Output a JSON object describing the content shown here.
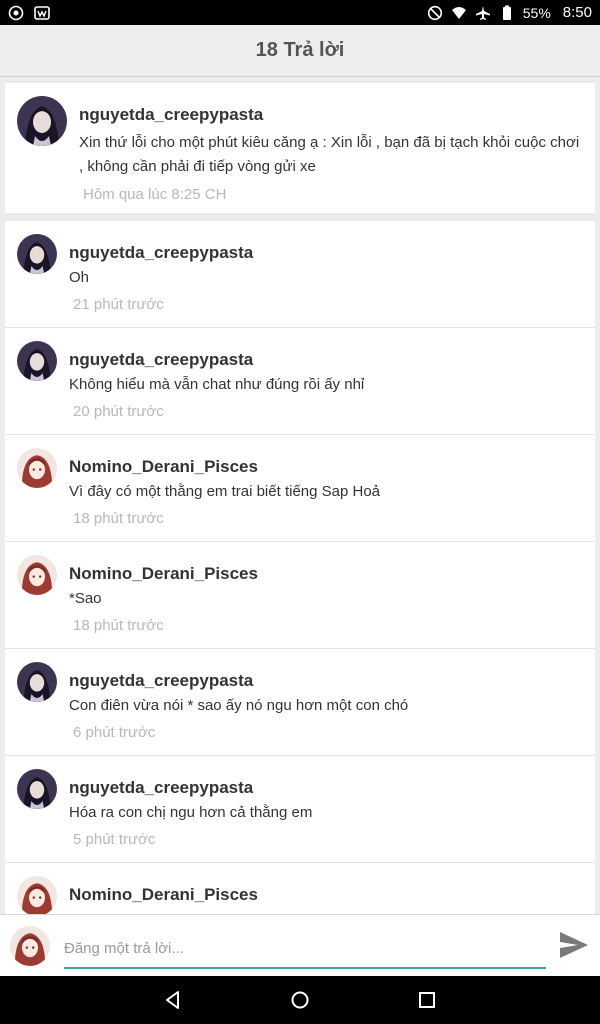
{
  "status_bar": {
    "battery": "55%",
    "time": "8:50",
    "icons": [
      "camera-icon",
      "app-icon",
      "dnd-icon",
      "wifi-icon",
      "airplane-icon",
      "battery-icon"
    ]
  },
  "header": {
    "title": "18 Trả lời"
  },
  "original_post": {
    "author": "nguyetda_creepypasta",
    "text": "Xin thứ lỗi cho một phút kiêu căng ạ : Xin lỗi , bạn đã bị tạch khỏi cuộc chơi , không cần phải đi tiếp vòng gửi xe",
    "time": "Hôm qua lúc 8:25 CH"
  },
  "replies": [
    {
      "author": "nguyetda_creepypasta",
      "text": "Oh",
      "time": "21 phút trước",
      "avatar": "dark"
    },
    {
      "author": "nguyetda_creepypasta",
      "text": "Không hiểu mà vẫn chat như đúng rồi ấy nhỉ",
      "time": "20 phút trước",
      "avatar": "dark"
    },
    {
      "author": "Nomino_Derani_Pisces",
      "text": "Vì đây có một thằng em trai biết tiếng Sap Hoả",
      "time": "18 phút trước",
      "avatar": "red"
    },
    {
      "author": "Nomino_Derani_Pisces",
      "text": "*Sao",
      "time": "18 phút trước",
      "avatar": "red"
    },
    {
      "author": "nguyetda_creepypasta",
      "text": "Con điên vừa nói * sao ấy nó ngu hơn một con chó",
      "time": "6 phút trước",
      "avatar": "dark"
    },
    {
      "author": "nguyetda_creepypasta",
      "text": "Hóa ra con chị ngu hơn cả thằng em",
      "time": "5 phút trước",
      "avatar": "dark"
    },
    {
      "author": "Nomino_Derani_Pisces",
      "text": "",
      "time": "",
      "avatar": "red"
    }
  ],
  "composer": {
    "placeholder": "Đăng một trả lời..."
  },
  "colors": {
    "accent": "#3ea3a6",
    "muted_text": "#b8b8b8",
    "header_text": "#555555"
  }
}
